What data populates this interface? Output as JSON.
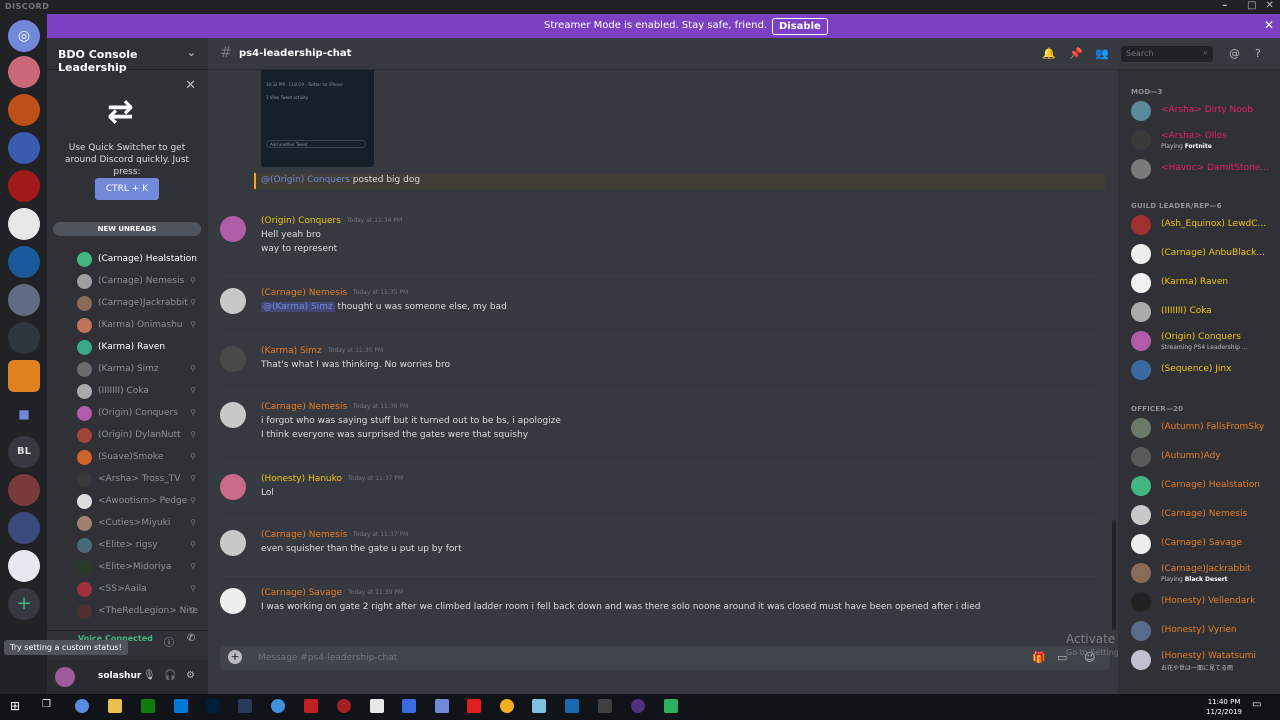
{
  "app": {
    "title": "DISCORD"
  },
  "banner": {
    "message": "Streamer Mode is enabled. Stay safe, friend.",
    "button": "Disable"
  },
  "server": {
    "name": "BDO Console Leadership"
  },
  "quick_switcher": {
    "text": "Use Quick Switcher to get around Discord quickly. Just press:",
    "shortcut": "CTRL + K"
  },
  "new_unreads": "NEW UNREADS",
  "voice_list": [
    {
      "name": "(Carnage) Healstation",
      "active": true,
      "color": "#43b581"
    },
    {
      "name": "(Carnage) Nemesis",
      "active": false,
      "color": "#9e9e9e"
    },
    {
      "name": "(Carnage)Jackrabbit",
      "active": false,
      "color": "#8a6b57"
    },
    {
      "name": "(Karma) Onimashu",
      "active": false,
      "color": "#c0745a"
    },
    {
      "name": "(Karma) Raven",
      "active": true,
      "color": "#3aa88a"
    },
    {
      "name": "(Karma) Simz",
      "active": false,
      "color": "#6a6a6a"
    },
    {
      "name": "(IIIIIII) Coka",
      "active": false,
      "color": "#aaaaaa"
    },
    {
      "name": "(Origin) Conquers",
      "active": false,
      "color": "#b05ca8"
    },
    {
      "name": "(Origin) DylanNutt",
      "active": false,
      "color": "#a0453a"
    },
    {
      "name": "(Suave)Smoke",
      "active": false,
      "color": "#d0642a"
    },
    {
      "name": "<Arsha> Tross_TV",
      "active": false,
      "color": "#3a3a3a"
    },
    {
      "name": "<Awootism> Pedge",
      "active": false,
      "color": "#dddddd"
    },
    {
      "name": "<Cuties>Miyuki",
      "active": false,
      "color": "#a08070"
    },
    {
      "name": "<Elite> rigsy",
      "active": false,
      "color": "#4a6a7a"
    },
    {
      "name": "<Elite>Midoriya",
      "active": false,
      "color": "#2a3a2a"
    },
    {
      "name": "<SS>Aaila",
      "active": false,
      "color": "#a03040"
    },
    {
      "name": "<TheRedLegion> Nite",
      "active": false,
      "color": "#503030"
    }
  ],
  "voice_status": {
    "label": "Voice Connected",
    "sub": "/ BDO ..."
  },
  "tooltip": "Try setting a custom status!",
  "user": {
    "name": "solashur"
  },
  "channel": {
    "name": "ps4-leadership-chat",
    "search_placeholder": "Search"
  },
  "embed": {
    "line1": "10:32 PM · 11/2/19 · Twitter for iPhone",
    "line2": "1 View Tweet activity",
    "reply": "Add another Tweet"
  },
  "mention": {
    "user": "@(Origin) Conquers",
    "text": " posted big dog"
  },
  "messages": [
    {
      "author": "(Origin) Conquers",
      "color": "#f1c40f",
      "time": "Today at 11:34 PM",
      "lines": [
        "Hell yeah bro",
        "way to represent"
      ],
      "avatar": "#b05ca8"
    },
    {
      "author": "(Carnage) Nemesis",
      "color": "#e67e22",
      "time": "Today at 11:35 PM",
      "mention": "@(Karma) Simz",
      "lines": [
        "thought u was someone else, my bad"
      ],
      "avatar": "#c8c8c8"
    },
    {
      "author": "(Karma) Simz",
      "color": "#e67e22",
      "time": "Today at 11:35 PM",
      "lines": [
        "That's what I was thinking. No worries bro"
      ],
      "avatar": "#4a4a4a"
    },
    {
      "author": "(Carnage) Nemesis",
      "color": "#e67e22",
      "time": "Today at 11:36 PM",
      "lines": [
        "i forgot who was saying stuff but it turned out to be bs, i apologize",
        "I think everyone was surprised the gates were that squishy"
      ],
      "avatar": "#c8c8c8"
    },
    {
      "author": "(Honesty) Hanuko",
      "color": "#f1c40f",
      "time": "Today at 11:37 PM",
      "lines": [
        "Lol"
      ],
      "avatar": "#c86a8a"
    },
    {
      "author": "(Carnage) Nemesis",
      "color": "#e67e22",
      "time": "Today at 11:37 PM",
      "lines": [
        "even squisher than the gate u put up by fort"
      ],
      "avatar": "#c8c8c8"
    },
    {
      "author": "(Carnage) Savage",
      "color": "#e67e22",
      "time": "Today at 11:39 PM",
      "lines": [
        "I was working on gate 2 right after we climbed ladder room i fell back down and was there solo noone around it was closed must have been opened after i died"
      ],
      "avatar": "#eeeeee"
    }
  ],
  "composer": {
    "placeholder": "Message #ps4-leadership-chat"
  },
  "watermark": {
    "title": "Activate Windows",
    "sub": "Go to Settings to activate Windows."
  },
  "members": {
    "categories": [
      "MOD—3",
      "GUILD LEADER/REP—6",
      "OFFICER—20"
    ],
    "mods": [
      {
        "name": "<Arsha> Dirty Noob",
        "color": "#e91e63",
        "status": "",
        "avatar": "#5a8a9a"
      },
      {
        "name": "<Arsha> Ollos",
        "color": "#e91e63",
        "status": "Playing ",
        "game": "Fortnite",
        "avatar": "#3a3a3a"
      },
      {
        "name": "<Havoc> DamitStone...",
        "color": "#e91e63",
        "status": "",
        "avatar": "#7a7a7a"
      }
    ],
    "leaders": [
      {
        "name": "(Ash_Equinox) LewdC...",
        "color": "#f1c40f",
        "status": "",
        "avatar": "#a03030"
      },
      {
        "name": "(Carnage) AnbuBlack...",
        "color": "#f1c40f",
        "status": "",
        "avatar": "#eeeeee"
      },
      {
        "name": "(Karma) Raven",
        "color": "#f1c40f",
        "status": "",
        "avatar": "#f0f0f0"
      },
      {
        "name": "(IIIIIII) Coka",
        "color": "#f1c40f",
        "status": "",
        "avatar": "#aaaaaa"
      },
      {
        "name": "(Origin) Conquers",
        "color": "#f1c40f",
        "status": "Streaming PS4 Leadership ...",
        "game": "",
        "avatar": "#b05ca8"
      },
      {
        "name": "(Sequence) Jinx",
        "color": "#f1c40f",
        "status": "",
        "avatar": "#3a6aa0"
      }
    ],
    "officers": [
      {
        "name": "(Autumn) FallsFromSky",
        "color": "#e67e22",
        "status": "",
        "avatar": "#6a7a6a"
      },
      {
        "name": "(Autumn)Ady",
        "color": "#e67e22",
        "status": "",
        "avatar": "#5a5a5a"
      },
      {
        "name": "(Carnage) Healstation",
        "color": "#e67e22",
        "status": "",
        "avatar": "#43b581"
      },
      {
        "name": "(Carnage) Nemesis",
        "color": "#e67e22",
        "status": "",
        "avatar": "#c8c8c8"
      },
      {
        "name": "(Carnage) Savage",
        "color": "#e67e22",
        "status": "",
        "avatar": "#eeeeee"
      },
      {
        "name": "(Carnage)Jackrabbit",
        "color": "#e67e22",
        "status": "Playing ",
        "game": "Black Desert",
        "avatar": "#8a6b57"
      },
      {
        "name": "(Honesty) Vellendark",
        "color": "#e67e22",
        "status": "",
        "avatar": "#222222"
      },
      {
        "name": "(Honesty) Vyrien",
        "color": "#e67e22",
        "status": "",
        "avatar": "#5a6a8a"
      },
      {
        "name": "(Honesty) Watatsumi",
        "color": "#e67e22",
        "status": "お花や世は一面に見てる雨",
        "game": "",
        "avatar": "#c0c0d0"
      }
    ]
  },
  "clock": {
    "time": "11:40 PM",
    "date": "11/2/2019"
  }
}
